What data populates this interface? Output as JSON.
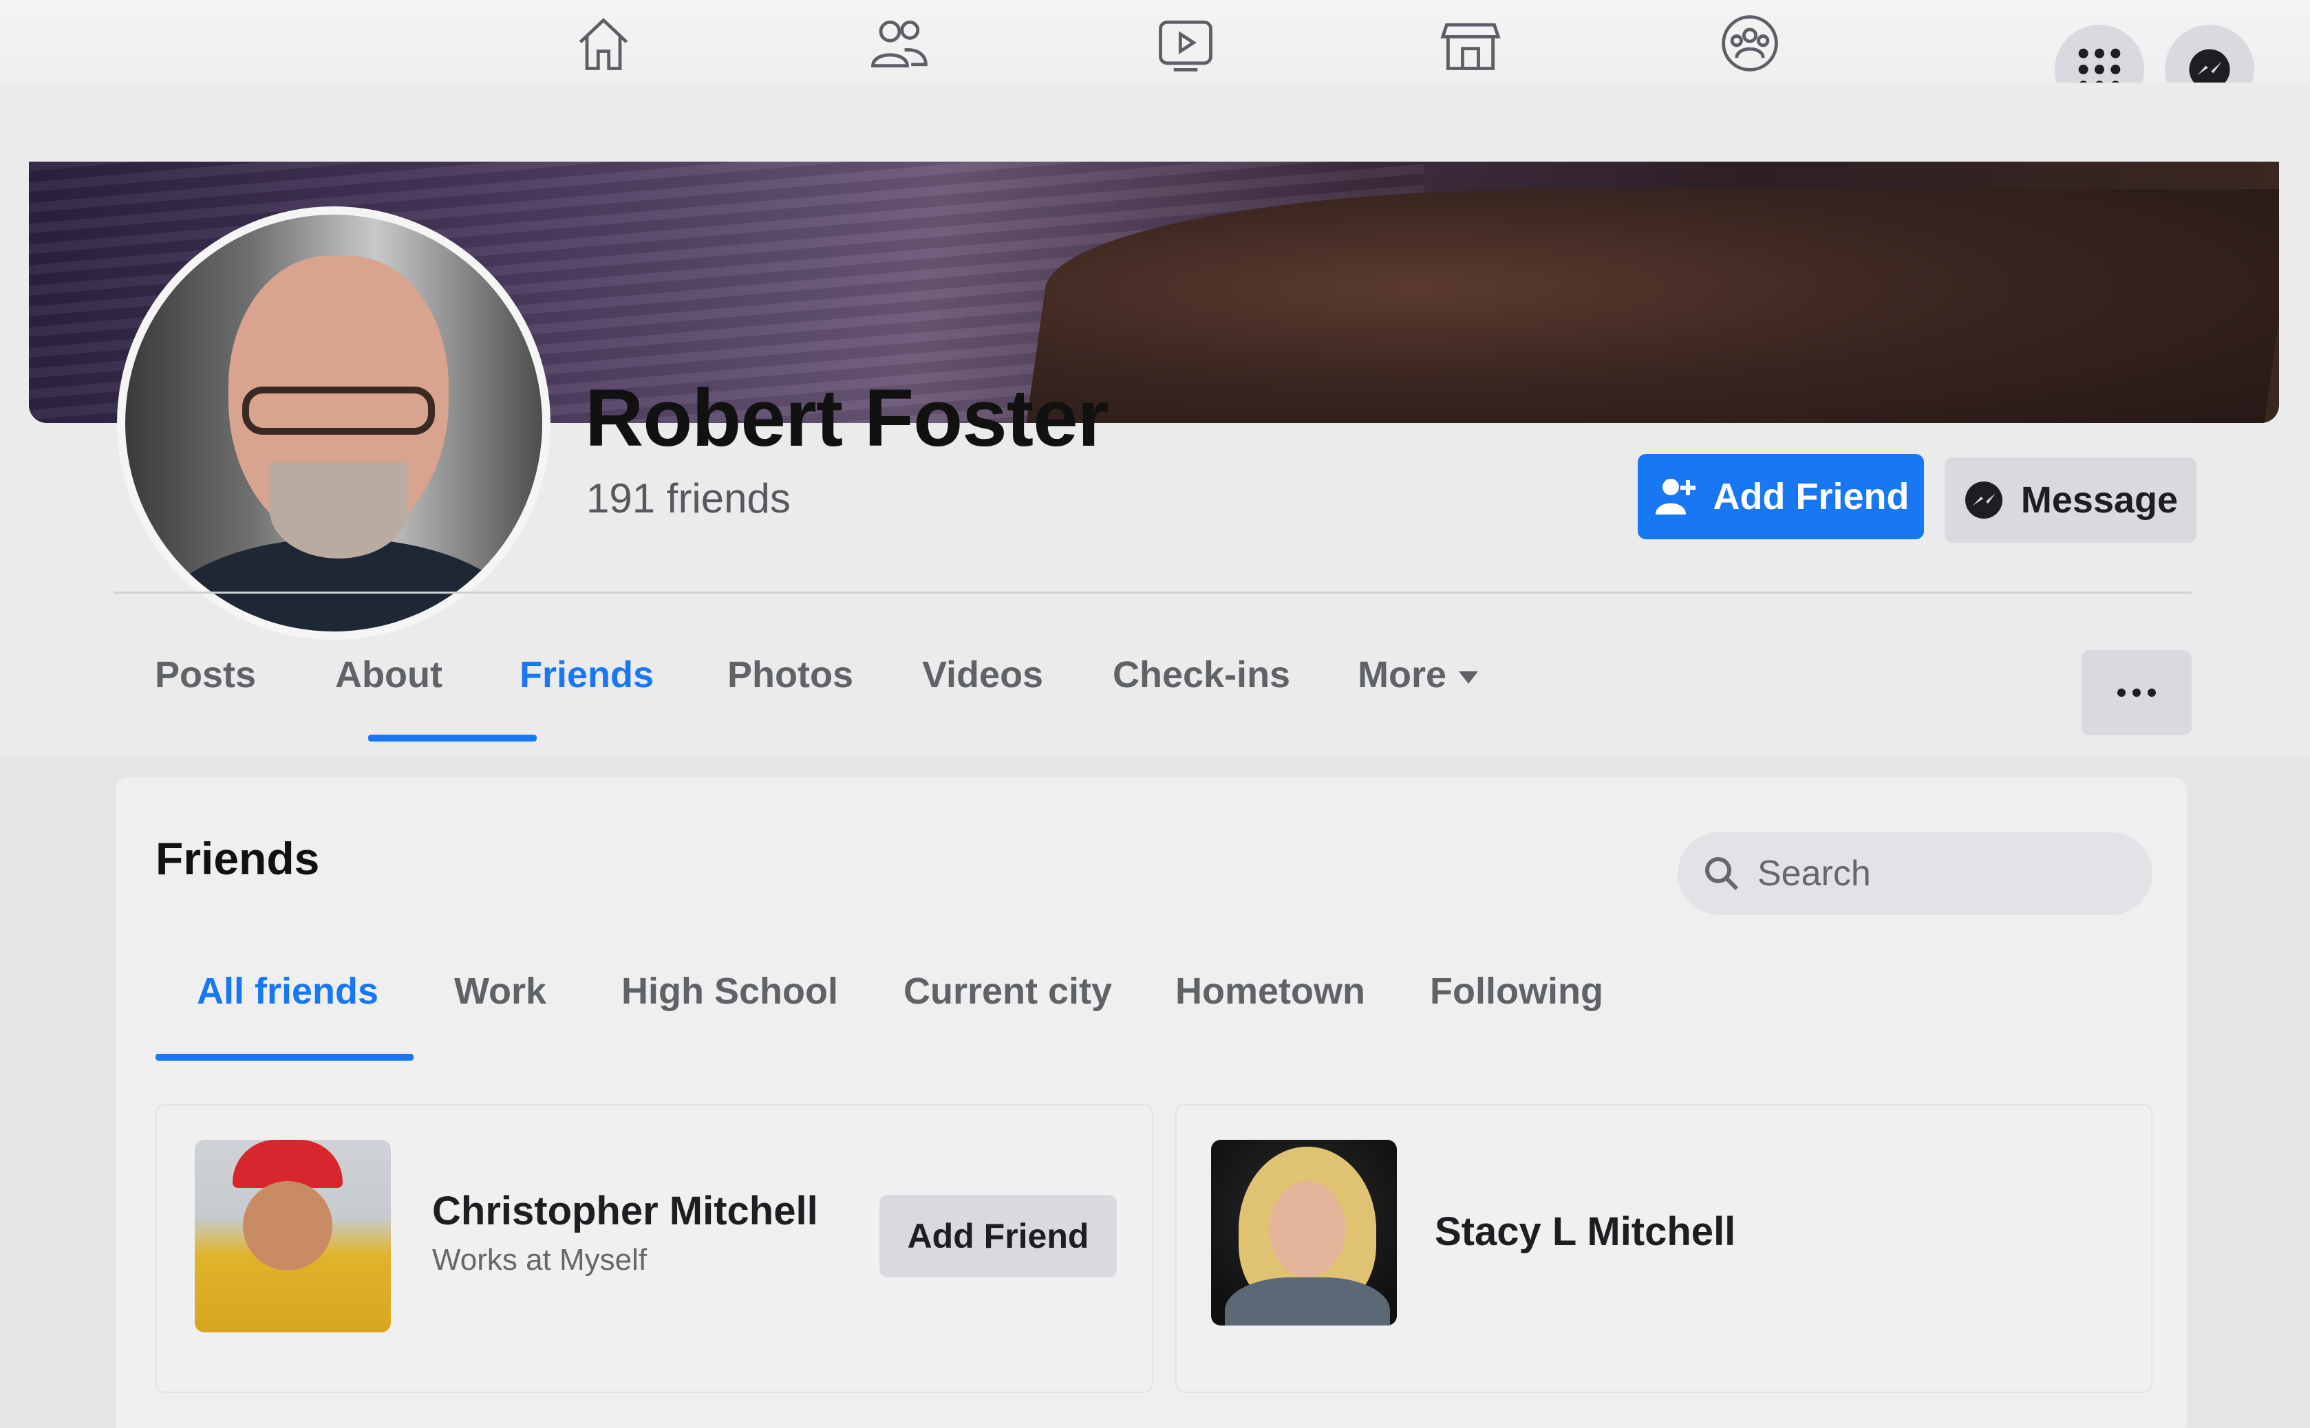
{
  "nav": {
    "icons": [
      "home-icon",
      "friends-icon",
      "watch-icon",
      "marketplace-icon",
      "groups-icon",
      "menu-grid-icon",
      "messenger-icon"
    ]
  },
  "profile": {
    "name": "Robert Foster",
    "friends_count": "191 friends",
    "add_friend_label": "Add Friend",
    "message_label": "Message"
  },
  "tabs": [
    "Posts",
    "About",
    "Friends",
    "Photos",
    "Videos",
    "Check-ins",
    "More"
  ],
  "active_tab": "Friends",
  "friends_section": {
    "title": "Friends",
    "search_placeholder": "Search",
    "subtabs": [
      "All friends",
      "Work",
      "High School",
      "Current city",
      "Hometown",
      "Following"
    ],
    "active_subtab": "All friends",
    "list": [
      {
        "name": "Christopher Mitchell",
        "subtitle": "Works at Myself",
        "action_label": "Add Friend"
      },
      {
        "name": "Stacy L Mitchell"
      }
    ]
  },
  "colors": {
    "accent": "#1877f2",
    "button_gray": "#d8dadf",
    "text_muted": "#65676b"
  }
}
